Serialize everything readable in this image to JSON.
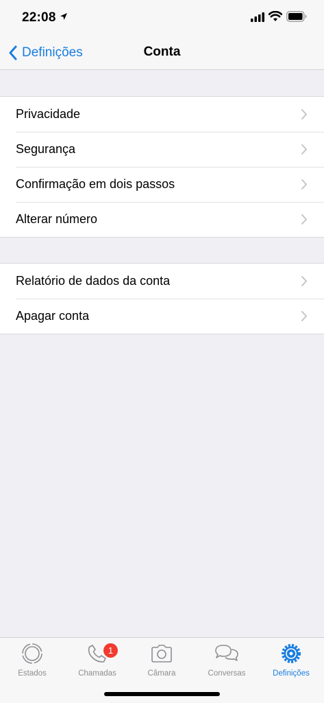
{
  "status": {
    "time": "22:08"
  },
  "nav": {
    "back_label": "Definições",
    "title": "Conta"
  },
  "groups": [
    {
      "items": [
        {
          "label": "Privacidade"
        },
        {
          "label": "Segurança"
        },
        {
          "label": "Confirmação em dois passos"
        },
        {
          "label": "Alterar número"
        }
      ]
    },
    {
      "items": [
        {
          "label": "Relatório de dados da conta"
        },
        {
          "label": "Apagar conta"
        }
      ]
    }
  ],
  "tabbar": {
    "tabs": [
      {
        "label": "Estados",
        "icon": "status-ring-icon",
        "active": false
      },
      {
        "label": "Chamadas",
        "icon": "phone-icon",
        "active": false,
        "badge": "1"
      },
      {
        "label": "Câmara",
        "icon": "camera-icon",
        "active": false
      },
      {
        "label": "Conversas",
        "icon": "chat-bubbles-icon",
        "active": false
      },
      {
        "label": "Definições",
        "icon": "gear-icon",
        "active": true
      }
    ]
  },
  "colors": {
    "accent": "#1a7ee0",
    "badge": "#f23b30",
    "background": "#efeff4",
    "inactive": "#8e8e93"
  }
}
